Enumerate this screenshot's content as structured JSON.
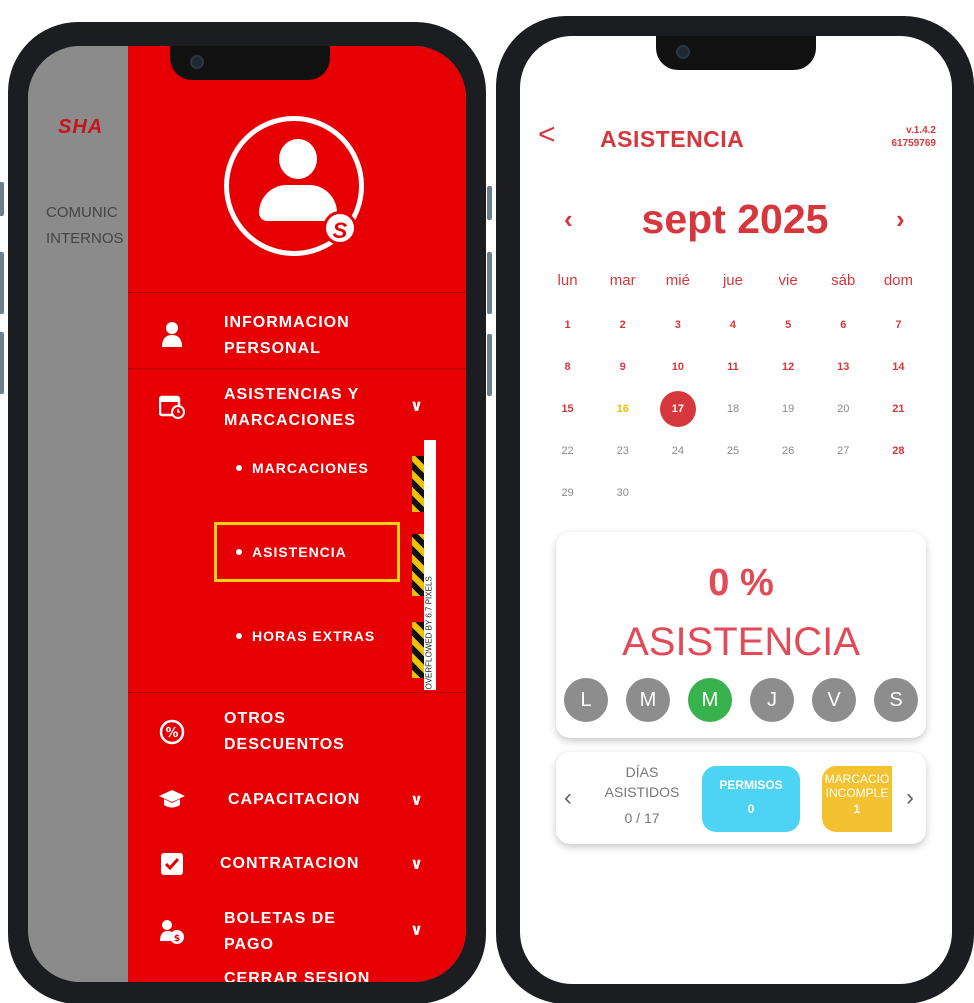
{
  "left": {
    "background_app": {
      "logo": "SHA",
      "text": "COMUNIC\nINTERNOS"
    },
    "menu": {
      "items": [
        {
          "label": "INFORMACION\nPERSONAL",
          "icon": "person-icon"
        },
        {
          "label": "ASISTENCIAS Y\nMARCACIONES",
          "icon": "calendar-clock-icon"
        },
        {
          "label": "OTROS\nDESCUENTOS",
          "icon": "percent-icon"
        },
        {
          "label": "CAPACITACION",
          "icon": "graduation-cap-icon"
        },
        {
          "label": "CONTRATACION",
          "icon": "checkbox-icon"
        },
        {
          "label": "BOLETAS DE\nPAGO",
          "icon": "payroll-icon"
        },
        {
          "label": "CERRAR SESION"
        }
      ],
      "subitems": [
        "MARCACIONES",
        "ASISTENCIA",
        "HORAS EXTRAS"
      ],
      "avatar_badge": "S"
    },
    "overflow_warning": "OVERFLOWED BY 6.7 PIXELS",
    "colors": {
      "drawer": "#e60003",
      "highlight": "#f5cf11"
    }
  },
  "right": {
    "header": {
      "title": "ASISTENCIA",
      "version": "v.1.4.2",
      "code": "61759769",
      "back": "<"
    },
    "calendar": {
      "month": "sept 2025",
      "prev": "‹",
      "next": "›",
      "weekdays": [
        "lun",
        "mar",
        "mié",
        "jue",
        "vie",
        "sáb",
        "dom"
      ],
      "days": [
        {
          "d": "1",
          "s": "red"
        },
        {
          "d": "2",
          "s": "red"
        },
        {
          "d": "3",
          "s": "red"
        },
        {
          "d": "4",
          "s": "red"
        },
        {
          "d": "5",
          "s": "red"
        },
        {
          "d": "6",
          "s": "red"
        },
        {
          "d": "7",
          "s": "red"
        },
        {
          "d": "8",
          "s": "red"
        },
        {
          "d": "9",
          "s": "red"
        },
        {
          "d": "10",
          "s": "red"
        },
        {
          "d": "11",
          "s": "red"
        },
        {
          "d": "12",
          "s": "red"
        },
        {
          "d": "13",
          "s": "red"
        },
        {
          "d": "14",
          "s": "red"
        },
        {
          "d": "15",
          "s": "red"
        },
        {
          "d": "16",
          "s": "yellow"
        },
        {
          "d": "17",
          "s": "sel"
        },
        {
          "d": "18",
          "s": "gray"
        },
        {
          "d": "19",
          "s": "gray"
        },
        {
          "d": "20",
          "s": "gray"
        },
        {
          "d": "21",
          "s": "red"
        },
        {
          "d": "22",
          "s": "gray"
        },
        {
          "d": "23",
          "s": "gray"
        },
        {
          "d": "24",
          "s": "gray"
        },
        {
          "d": "25",
          "s": "gray"
        },
        {
          "d": "26",
          "s": "gray"
        },
        {
          "d": "27",
          "s": "gray"
        },
        {
          "d": "28",
          "s": "red"
        },
        {
          "d": "29",
          "s": "gray"
        },
        {
          "d": "30",
          "s": "gray"
        }
      ]
    },
    "attendance": {
      "percent": "0 %",
      "label": "ASISTENCIA",
      "weekdays": [
        "L",
        "M",
        "M",
        "J",
        "V",
        "S"
      ],
      "active_index": 2
    },
    "summary": {
      "dias_label": "DÍAS\nASISTIDOS",
      "dias_value": "0 / 17",
      "permisos_label": "PERMISOS",
      "permisos_value": "0",
      "marcaciones_label": "MARCACIO\nINCOMPLE",
      "marcaciones_value": "1",
      "prev": "‹",
      "next": "›"
    },
    "colors": {
      "accent": "#d6373d",
      "active_day": "#37b24d",
      "permisos": "#4dd4f4",
      "marcaciones": "#f2c230"
    }
  }
}
